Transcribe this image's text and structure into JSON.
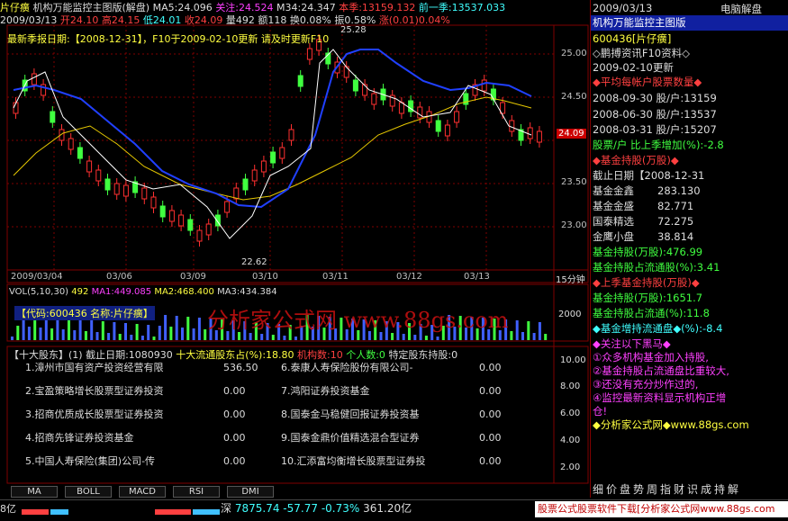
{
  "stock_name": "片仔癀",
  "indicator_title": "机构万能监控主图版(解盘)",
  "ma5": "MA5:24.096",
  "guanzhu": "关注:24.524",
  "m34": "M34:24.347",
  "benji": "本季:13159.132",
  "qianyiji": "前一季:13537.033",
  "info_line": {
    "date": "2009/03/13",
    "open": "开24.10",
    "high": "高24.15",
    "low": "低24.01",
    "close": "收24.09",
    "vol": "量492",
    "amt": "额118",
    "huan": "换0.08%",
    "zhen": "振0.58%",
    "zhang": "涨(0.01)0.04%"
  },
  "notice": "最新季报日期:【2008-12-31】，F10于2009-02-10更新 请及时更新F10",
  "price_labels": [
    "25.00",
    "24.50",
    "24.00",
    "23.50",
    "23.00"
  ],
  "current_price": "24.09",
  "high_mark": "25.28",
  "low_mark": "22.62",
  "x_labels": [
    "2009/03/04",
    "03/06",
    "03/09",
    "03/10",
    "03/11",
    "03/12",
    "03/13"
  ],
  "period": "15分钟",
  "vol_header": {
    "vol": "VOL(5,10,30)",
    "v": "492",
    "ma1": "MA1:449.085",
    "ma2": "MA2:468.400",
    "ma3": "MA3:434.384"
  },
  "vol_tag": "【代码:600436 名称:片仔癀】",
  "vol_scale": "2000",
  "watermark": "分析家公式网 www.88gs.com",
  "table_header": {
    "title": "【十大股东】(1) 截止日期:1080930",
    "ltgd": "十大流通股东占(%):18.80",
    "jg": "机构数:10",
    "gr": "个人数:0",
    "td": "特定股东持股:0"
  },
  "holders_left": [
    {
      "name": "1.漳州市国有资产投资经营有限",
      "val": "536.50"
    },
    {
      "name": "2.宝盈策略增长股票型证券投资",
      "val": "0.00"
    },
    {
      "name": "3.招商优质成长股票型证券投资",
      "val": "0.00"
    },
    {
      "name": "4.招商先锋证券投资基金",
      "val": "0.00"
    },
    {
      "name": "5.中国人寿保险(集团)公司-传",
      "val": "0.00"
    }
  ],
  "holders_right": [
    {
      "name": "6.泰康人寿保险股份有限公司-",
      "val": "0.00"
    },
    {
      "name": "7.鸿阳证券投资基金",
      "val": "0.00"
    },
    {
      "name": "8.国泰金马稳健回报证券投资基",
      "val": "0.00"
    },
    {
      "name": "9.国泰金鼎价值精选混合型证券",
      "val": "0.00"
    },
    {
      "name": "10.汇添富均衡增长股票型证券投",
      "val": "0.00"
    }
  ],
  "lower_scale": [
    "10.00",
    "8.00",
    "6.00",
    "4.00",
    "2.00"
  ],
  "tabs": [
    "MA",
    "BOLL",
    "MACD",
    "RSI",
    "DMI"
  ],
  "right": {
    "date": "2009/03/13",
    "mode": "电脑解盘",
    "title": "机构万能监控主图版",
    "code": "600436[片仔癀]",
    "f10": "◇鹏搏资讯F10资料◇",
    "update": "2009-02-10更新",
    "s1": "◆平均每帐户股票数量◆",
    "r1": "2008-09-30 股/户:13159",
    "r2": "2008-06-30 股/户:13537",
    "r3": "2008-03-31 股/户:15207",
    "r4": "股票/户 比上季增加(%):-2.8",
    "s2": "◆基金持股(万股)◆",
    "r5": "截止日期【2008-12-31",
    "f1n": "基金金鑫",
    "f1v": "283.130",
    "f2n": "基金金盛",
    "f2v": "82.771",
    "f3n": "国泰精选",
    "f3v": "72.275",
    "f4n": "金鹰小盘",
    "f4v": "38.814",
    "r6": "基金持股(万股):476.99",
    "r7": "基金持股占流通股(%):3.41",
    "s3": "◆上季基金持股(万股)◆",
    "r8": "基金持股(万股):1651.7",
    "r9": "基金持股占流通(%):11.8",
    "r10": "◆基金增持流通盘◆(%):-8.4",
    "s4": "◆关注以下黑马◆",
    "n1": "①众多机构基金加入持股,",
    "n2": "②基金持股占流通盘比重较大,",
    "n3": "③还没有充分炒作过的,",
    "n4": "④监控最新资料显示机构正增",
    "n5": "仓!",
    "site": "◆分析家公式网◆www.88gs.com",
    "bottom_tabs": "细价盘势周指财识成持解"
  },
  "status": {
    "sz": "深",
    "idx": "7875.74",
    "chg": "-57.77",
    "pct": "-0.73%",
    "amt": "361.20亿",
    "left": "8亿",
    "ad": "股票公式股票软件下载[分析家公式网www.88gs.com"
  }
}
